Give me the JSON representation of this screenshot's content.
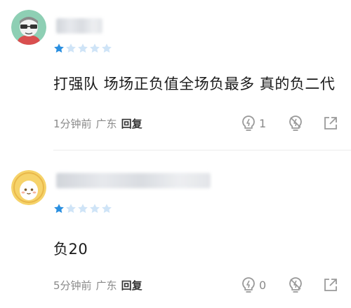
{
  "comments": [
    {
      "username": "",
      "rating": 1,
      "max_rating": 5,
      "content": "打强队 场场正负值全场负最多 真的负二代",
      "time": "1分钟前",
      "location": "广东",
      "reply_label": "回复",
      "like_count": "1",
      "avatar_icon": "face-with-glasses-avatar"
    },
    {
      "username": "",
      "rating": 1,
      "max_rating": 5,
      "content": "负20",
      "time": "5分钟前",
      "location": "广东",
      "reply_label": "回复",
      "like_count": "0",
      "avatar_icon": "egg-character-avatar"
    }
  ],
  "colors": {
    "star_active": "#2a8fe0",
    "star_inactive": "#cfe4f7",
    "meta_text": "#8a8a8a",
    "icon_gray": "#9a9a9a"
  }
}
